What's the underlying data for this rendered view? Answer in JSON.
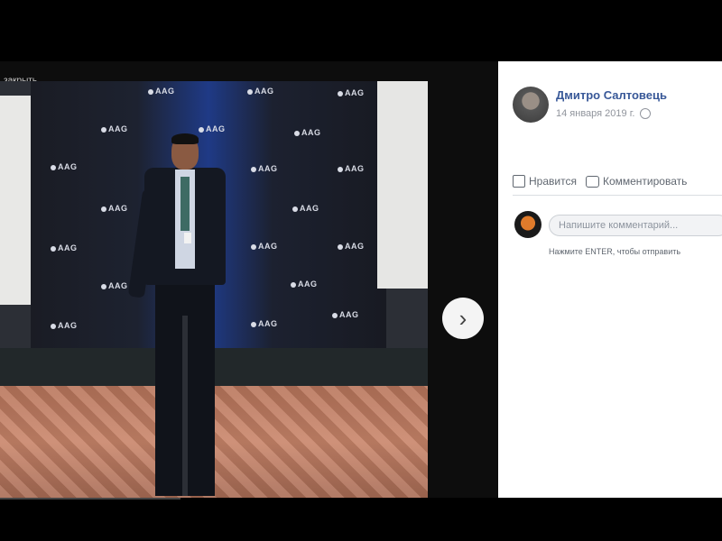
{
  "viewer": {
    "close_label": "закрыть",
    "next_icon": "chevron-right-icon",
    "logo_text": "AAG"
  },
  "post": {
    "author": "Дмитро Салтовець",
    "date": "14 января 2019 г.",
    "privacy_icon": "globe-icon",
    "like_label": "Нравится",
    "comment_label": "Комментировать",
    "comment_placeholder": "Напишите комментарий...",
    "hint": "Нажмите ENTER, чтобы отправить"
  }
}
